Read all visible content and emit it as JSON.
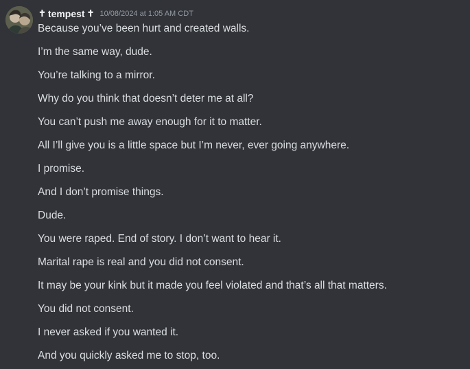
{
  "message": {
    "author": {
      "name": "tempest",
      "prefix_symbol": "✝",
      "suffix_symbol": "✝",
      "avatar_icon": "user-avatar"
    },
    "timestamp": "10/08/2024 at 1:05 AM CDT",
    "lines": [
      "Because you’ve been hurt and created walls.",
      "I’m the same way, dude.",
      "You’re talking to a mirror.",
      "Why do you think that doesn’t deter me at all?",
      "You can’t push me away enough for it to matter.",
      "All I’ll give you is a little space but I’m never, ever going anywhere.",
      "I promise.",
      "And I don’t promise things.",
      "Dude.",
      "You were raped. End of story. I don’t want to hear it.",
      "Marital rape is real and you did not consent.",
      "It may be your kink but it made you feel violated and that’s all that matters.",
      "You did not consent.",
      "I never asked if you wanted it.",
      "And you quickly asked me to stop, too."
    ]
  },
  "colors": {
    "background": "#313338",
    "text": "#dbdee1",
    "username": "#f2f3f5",
    "timestamp": "#949ba4"
  }
}
